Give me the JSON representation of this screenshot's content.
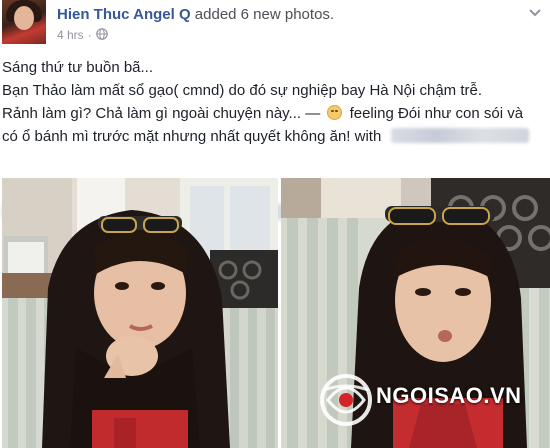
{
  "post": {
    "author": "Hien Thuc Angel Q",
    "action": "added 6 new photos.",
    "time": "4 hrs",
    "dot": "·",
    "lines": [
      "Sáng thứ tư buồn bã...",
      "Bạn Thảo làm mất sổ gạo( cmnd) do đó sự nghiệp bay Hà Nội chậm trễ.",
      "Rảnh làm gì? Chả làm gì ngoài chuyện này... —"
    ],
    "feeling_line_1": "feeling Đói như con sói và",
    "feeling_line_2": "có ổ bánh mì trước mặt nhưng nhất quyết không ăn! with",
    "icons": {
      "privacy": "globe-icon",
      "menu": "chevron-down-icon",
      "feeling": "smiley-emoji-icon"
    }
  },
  "watermark": {
    "text": "NGOISAO.VN",
    "brand_color": "#d6232a"
  }
}
